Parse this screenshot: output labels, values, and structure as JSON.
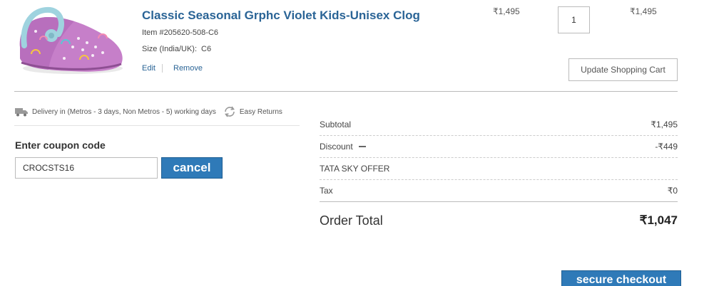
{
  "product": {
    "title": "Classic Seasonal Grphc Violet Kids-Unisex Clog",
    "item_number": "Item #205620-508-C6",
    "size_label": "Size (India/UK):",
    "size_value": "C6",
    "edit_label": "Edit",
    "remove_label": "Remove",
    "unit_price": "₹1,495",
    "quantity": "1",
    "line_total": "₹1,495",
    "image_icon": "purple-clog-with-rainbow-print"
  },
  "cart": {
    "update_label": "Update Shopping Cart"
  },
  "delivery": {
    "text": "Delivery in (Metros - 3 days, Non Metros - 5) working days",
    "returns_text": "Easy Returns",
    "truck_icon": "truck-icon",
    "returns_icon": "returns-cycle-icon"
  },
  "coupon": {
    "heading": "Enter coupon code",
    "value": "CROCSTS16",
    "cancel_label": "cancel"
  },
  "summary": {
    "subtotal_label": "Subtotal",
    "subtotal_value": "₹1,495",
    "discount_label": "Discount",
    "discount_value": "-₹449",
    "offer_label": "TATA SKY OFFER",
    "tax_label": "Tax",
    "tax_value": "₹0",
    "order_total_label": "Order Total",
    "order_total_value": "₹1,047"
  },
  "checkout": {
    "label": "secure checkout"
  },
  "colors": {
    "link_blue": "#2a6496",
    "button_blue": "#2f7ab8",
    "clog_purple": "#c67fc9",
    "clog_strap": "#9fd3df"
  }
}
